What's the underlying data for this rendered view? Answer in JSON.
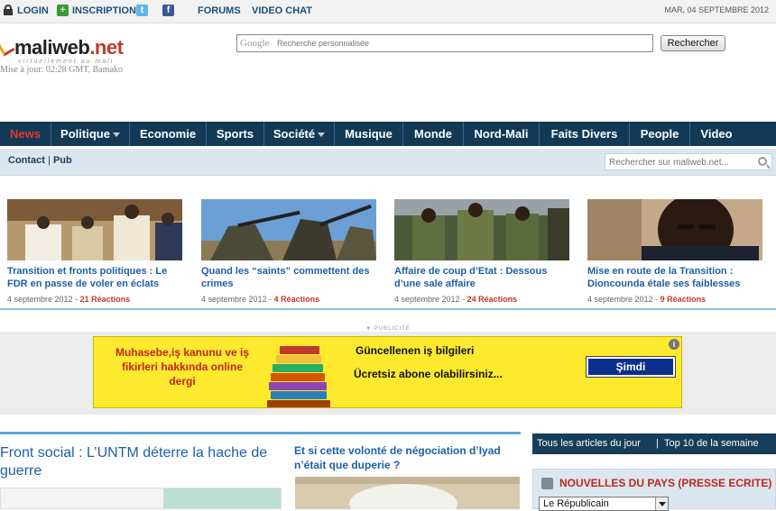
{
  "topbar": {
    "login": "LOGIN",
    "inscription": "INSCRIPTION",
    "forums": "FORUMS",
    "video_chat": "VIDEO CHAT",
    "date": "MAR, 04 SEPTEMBRE 2012"
  },
  "header": {
    "logo_main": "maliweb",
    "logo_suffix": ".net",
    "logo_tagline": "virtuellement au mali",
    "updated": "Mise à jour: 02:28 GMT, Bamako",
    "google_label": "Google",
    "search_placeholder": "Recherche personnalisée",
    "search_button": "Rechercher"
  },
  "nav": {
    "items": [
      {
        "label": "News"
      },
      {
        "label": "Politique"
      },
      {
        "label": "Economie"
      },
      {
        "label": "Sports"
      },
      {
        "label": "Société"
      },
      {
        "label": "Musique"
      },
      {
        "label": "Monde"
      },
      {
        "label": "Nord-Mali"
      },
      {
        "label": "Faits Divers"
      },
      {
        "label": "People"
      },
      {
        "label": "Video"
      }
    ]
  },
  "subnav": {
    "contact": "Contact",
    "pub": "Pub",
    "site_search_placeholder": "Rechercher sur maliweb.net..."
  },
  "featured": [
    {
      "title": "Transition et fronts politiques : Le FDR en passe de voler en éclats",
      "date": "4 septembre 2012",
      "reactions": "21 Réactions"
    },
    {
      "title": "Quand les “saints” commettent des crimes",
      "date": "4 septembre 2012",
      "reactions": "4 Réactions"
    },
    {
      "title": "Affaire de coup d’Etat : Dessous d’une sale affaire",
      "date": "4 septembre 2012",
      "reactions": "24 Réactions"
    },
    {
      "title": "Mise en route de la Transition : Dioncounda étale ses faiblesses",
      "date": "4 septembre 2012",
      "reactions": "9 Réactions"
    }
  ],
  "ad": {
    "label": "▼ PUBLICITÉ",
    "left_text": "Muhasebe,iş kanunu ve iş fikirleri hakkında online dergi",
    "right_line1": "Güncellenen iş bilgileri",
    "right_line2": "Ücretsiz abone olabilirsiniz...",
    "cta": "Şimdi",
    "info": "i"
  },
  "main": {
    "lead_title": "Front social : L’UNTM déterre la hache de guerre",
    "second_title": "Et si cette volonté de négociation d’Iyad n’était que duperie ?"
  },
  "sidebar": {
    "tab1": "Tous les articles du jour",
    "tab_sep": "|",
    "tab2": "Top 10 de la semaine",
    "pays_title": "NOUVELLES DU PAYS (PRESSE ECRITE)",
    "pays_selected": "Le Républicain"
  },
  "colors": {
    "nav_bg": "#123a57",
    "active_nav": "#e43b2c",
    "link": "#1d5fa8",
    "reaction": "#c0392b",
    "ad_bg": "#fde92e"
  }
}
